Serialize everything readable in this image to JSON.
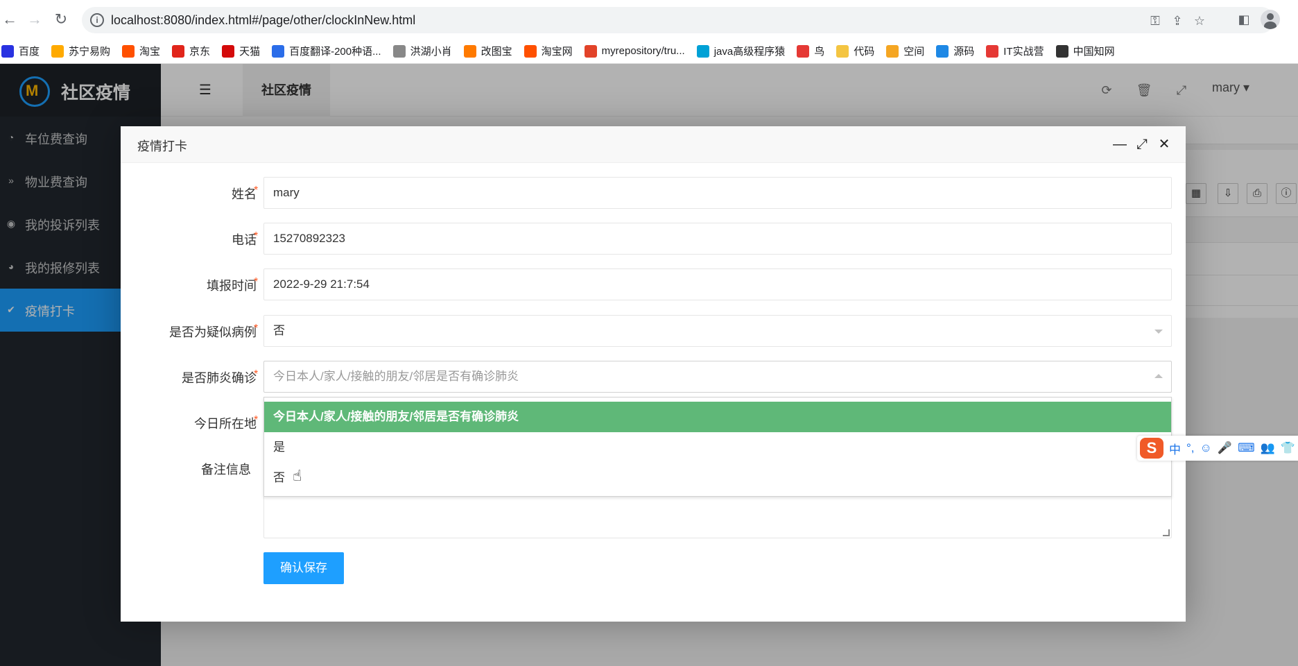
{
  "browser": {
    "url": "localhost:8080/index.html#/page/other/clockInNew.html",
    "bookmarks": [
      {
        "label": "百度",
        "color": "#2932e1"
      },
      {
        "label": "苏宁易购",
        "color": "#ffaa00"
      },
      {
        "label": "淘宝",
        "color": "#ff5000"
      },
      {
        "label": "京东",
        "color": "#e1251b"
      },
      {
        "label": "天猫",
        "color": "#d40a0a"
      },
      {
        "label": "百度翻译-200种语...",
        "color": "#2b6de9"
      },
      {
        "label": "洪湖小肖",
        "color": "#888888"
      },
      {
        "label": "改图宝",
        "color": "#ff7a00"
      },
      {
        "label": "淘宝网",
        "color": "#ff5000"
      },
      {
        "label": "myrepository/tru...",
        "color": "#e24329"
      },
      {
        "label": "java高级程序猿",
        "color": "#00a1d6"
      },
      {
        "label": "鸟",
        "color": "#e53935"
      },
      {
        "label": "代码",
        "color": "#f4c542"
      },
      {
        "label": "空间",
        "color": "#f5a623"
      },
      {
        "label": "源码",
        "color": "#1e88e5"
      },
      {
        "label": "IT实战营",
        "color": "#e53935"
      },
      {
        "label": "中国知网",
        "color": "#333333"
      }
    ]
  },
  "app": {
    "logo_text": "社区疫情",
    "logo_mark": "M",
    "top_tab": "社区疫情",
    "user": "mary ▾",
    "menu": [
      {
        "label": "车位费查询",
        "icon": "dashboard-icon",
        "glyph": "◔"
      },
      {
        "label": "物业费查询",
        "icon": "double-chevron-icon",
        "glyph": "»"
      },
      {
        "label": "我的投诉列表",
        "icon": "target-icon",
        "glyph": "◉"
      },
      {
        "label": "我的报修列表",
        "icon": "gauge-icon",
        "glyph": "◕"
      },
      {
        "label": "疫情打卡",
        "icon": "check-icon",
        "glyph": "✔"
      }
    ],
    "active_menu": 4
  },
  "dialog": {
    "title": "疫情打卡",
    "fields": {
      "name": {
        "label": "姓名",
        "value": "mary"
      },
      "phone": {
        "label": "电话",
        "value": "15270892323"
      },
      "time": {
        "label": "填报时间",
        "value": "2022-9-29 21:7:54"
      },
      "suspected": {
        "label": "是否为疑似病例",
        "value": "否"
      },
      "diagnosed": {
        "label": "是否肺炎确诊",
        "placeholder": "今日本人/家人/接触的朋友/邻居是否有确诊肺炎"
      },
      "location": {
        "label": "今日所在地"
      },
      "remark": {
        "label": "备注信息"
      }
    },
    "required_mark": "*",
    "dropdown_options": [
      "今日本人/家人/接触的朋友/邻居是否有确诊肺炎",
      "是",
      "否"
    ],
    "save_label": "确认保存"
  },
  "ime": {
    "logo": "S",
    "items": [
      "中",
      "°,",
      "☺",
      "🎤",
      "⌨",
      "👥",
      "👕"
    ]
  },
  "colors": {
    "primary": "#1e9fff",
    "sidebar": "#22282e",
    "selected_option": "#5fb878",
    "required": "#ff5722"
  }
}
